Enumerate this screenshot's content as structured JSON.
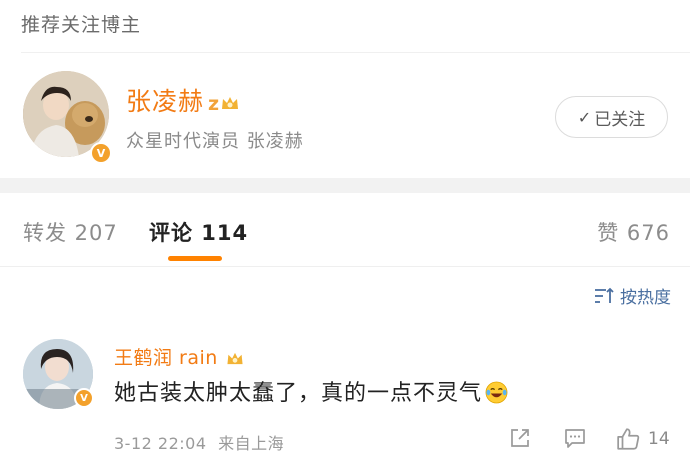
{
  "recommend": {
    "title": "推荐关注博主",
    "blogger": {
      "name": "张凌赫",
      "level_badge": "z",
      "description": "众星时代演员 张凌赫",
      "verified_badge": "V",
      "follow_label": "已关注",
      "follow_icon": "check-icon"
    }
  },
  "tabs": {
    "repost": "转发 207",
    "comments": "评论 114",
    "likes": "赞 676",
    "active_color": "#ff8200"
  },
  "sort": {
    "label": "按热度",
    "icon": "sort-icon"
  },
  "comment": {
    "author": "王鹤润 rain",
    "verified_badge": "V",
    "text": "她古装太肿太蠢了，真的一点不灵气",
    "emoji": "laughing-tears-emoji",
    "date": "3-12 22:04",
    "location": "来自上海",
    "like_count": "14",
    "actions": [
      "share-icon",
      "reply-icon",
      "thumbs-up-icon"
    ]
  },
  "colors": {
    "name_orange": "#f27b14",
    "link_blue": "#4a6fa0",
    "badge_gold": "#f3a12c"
  }
}
